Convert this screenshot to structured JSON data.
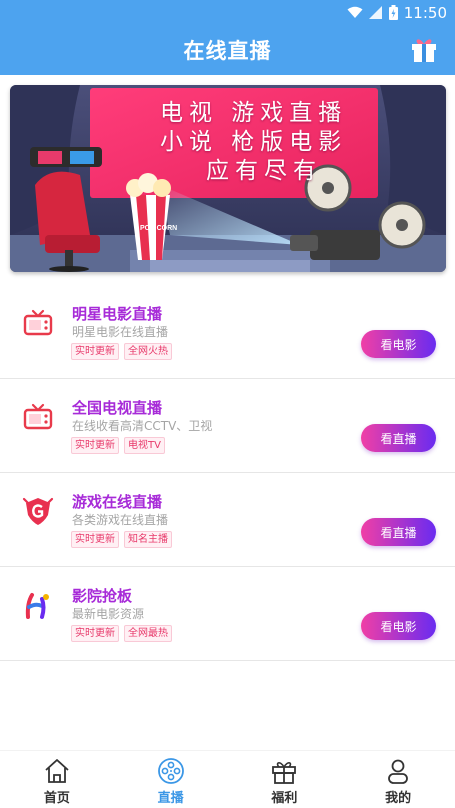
{
  "status_bar": {
    "time": "11:50"
  },
  "header": {
    "title": "在线直播",
    "gift_icon": "gift-icon"
  },
  "banner": {
    "line1": "电视 游戏直播",
    "line2": "小说 枪版电影",
    "line3": "应有尽有",
    "popcorn_label": "POP CORN"
  },
  "list": [
    {
      "icon": "tv-icon",
      "title": "明星电影直播",
      "subtitle": "明星电影在线直播",
      "tags": [
        "实时更新",
        "全网火热"
      ],
      "button": "看电影"
    },
    {
      "icon": "tv-icon",
      "title": "全国电视直播",
      "subtitle": "在线收看高清CCTV、卫视",
      "tags": [
        "实时更新",
        "电视TV"
      ],
      "button": "看直播"
    },
    {
      "icon": "game-shield-icon",
      "title": "游戏在线直播",
      "subtitle": "各类游戏在线直播",
      "tags": [
        "实时更新",
        "知名主播"
      ],
      "button": "看直播"
    },
    {
      "icon": "cinema-h-icon",
      "title": "影院抢板",
      "subtitle": "最新电影资源",
      "tags": [
        "实时更新",
        "全网最热"
      ],
      "button": "看电影"
    }
  ],
  "tab_bar": {
    "items": [
      {
        "label": "首页",
        "icon": "home-icon"
      },
      {
        "label": "直播",
        "icon": "film-reel-icon",
        "active": true
      },
      {
        "label": "福利",
        "icon": "gift-icon"
      },
      {
        "label": "我的",
        "icon": "user-icon"
      }
    ]
  },
  "colors": {
    "primary": "#4da3ef",
    "accent_purple": "#a72bd8",
    "tag_pink": "#e83a6b",
    "active_tab": "#3b97e6"
  }
}
